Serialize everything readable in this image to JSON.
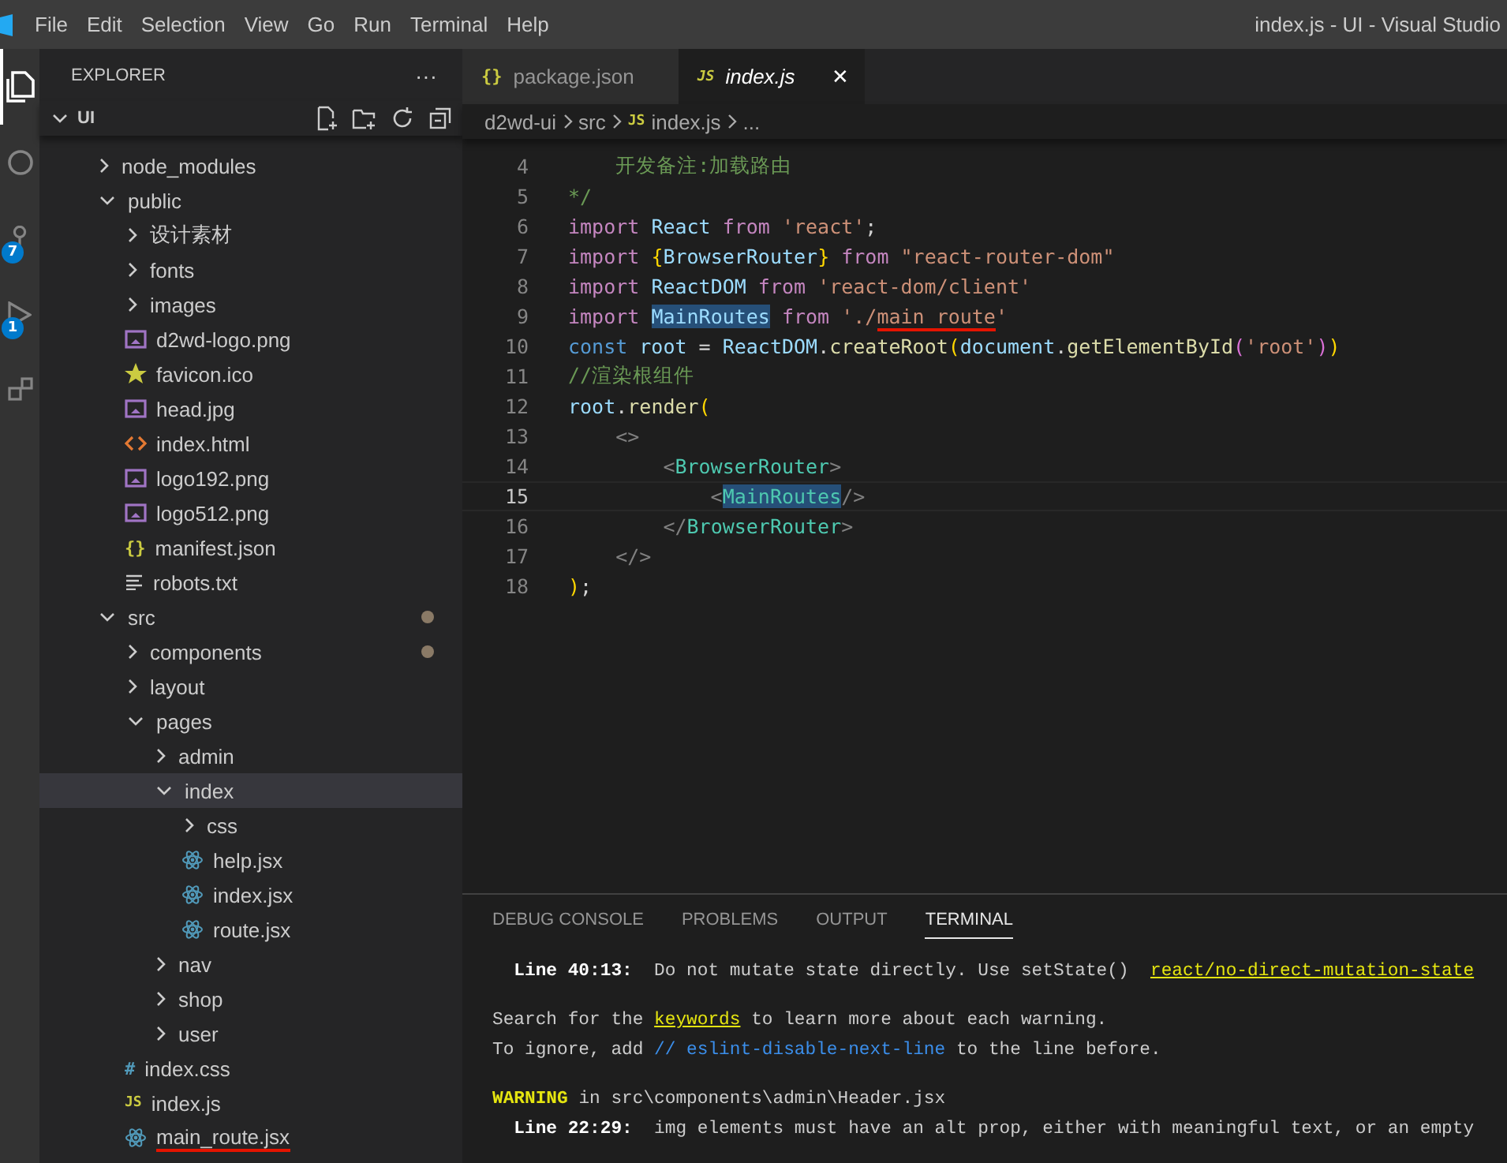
{
  "menu": [
    "File",
    "Edit",
    "Selection",
    "View",
    "Go",
    "Run",
    "Terminal",
    "Help"
  ],
  "window": {
    "title": "index.js - UI - Visual Studio"
  },
  "activity_bar": [
    {
      "kind": "files",
      "selected": true
    },
    {
      "kind": "search",
      "selected": false
    },
    {
      "kind": "source-control",
      "selected": false,
      "badge": "7"
    },
    {
      "kind": "run",
      "selected": false,
      "badge": "1"
    },
    {
      "kind": "extensions",
      "selected": false
    }
  ],
  "sidebar": {
    "title": "EXPLORER",
    "more": "···",
    "root": "UI",
    "tree": [
      {
        "name": "node_modules",
        "kind": "folder",
        "expanded": false,
        "selected": false
      },
      {
        "name": "public",
        "kind": "folder",
        "expanded": true,
        "selected": false,
        "children": [
          {
            "name": "设计素材",
            "kind": "folder",
            "expanded": false,
            "selected": false
          },
          {
            "name": "fonts",
            "kind": "folder",
            "expanded": false,
            "selected": false
          },
          {
            "name": "images",
            "kind": "folder",
            "expanded": false,
            "selected": false
          },
          {
            "name": "d2wd-logo.png",
            "kind": "image",
            "selected": false
          },
          {
            "name": "favicon.ico",
            "kind": "star",
            "selected": false
          },
          {
            "name": "head.jpg",
            "kind": "image",
            "selected": false
          },
          {
            "name": "index.html",
            "kind": "html",
            "selected": false
          },
          {
            "name": "logo192.png",
            "kind": "image",
            "selected": false
          },
          {
            "name": "logo512.png",
            "kind": "image",
            "selected": false
          },
          {
            "name": "manifest.json",
            "kind": "json",
            "icon": "{}",
            "selected": false
          },
          {
            "name": "robots.txt",
            "kind": "text",
            "selected": false
          }
        ]
      },
      {
        "name": "src",
        "kind": "folder",
        "expanded": true,
        "selected": false,
        "modified": true,
        "children": [
          {
            "name": "components",
            "kind": "folder",
            "expanded": false,
            "selected": false,
            "modified": true
          },
          {
            "name": "layout",
            "kind": "folder",
            "expanded": false,
            "selected": false
          },
          {
            "name": "pages",
            "kind": "folder",
            "expanded": true,
            "selected": false,
            "children": [
              {
                "name": "admin",
                "kind": "folder",
                "expanded": false,
                "selected": false
              },
              {
                "name": "index",
                "kind": "folder",
                "expanded": true,
                "selected": true,
                "children": [
                  {
                    "name": "css",
                    "kind": "folder",
                    "expanded": false,
                    "selected": false
                  },
                  {
                    "name": "help.jsx",
                    "kind": "react",
                    "selected": false
                  },
                  {
                    "name": "index.jsx",
                    "kind": "react",
                    "selected": false
                  },
                  {
                    "name": "route.jsx",
                    "kind": "react",
                    "selected": false
                  }
                ]
              },
              {
                "name": "nav",
                "kind": "folder",
                "expanded": false,
                "selected": false
              },
              {
                "name": "shop",
                "kind": "folder",
                "expanded": false,
                "selected": false
              },
              {
                "name": "user",
                "kind": "folder",
                "expanded": false,
                "selected": false
              }
            ]
          },
          {
            "name": "index.css",
            "kind": "css",
            "icon": "#",
            "selected": false
          },
          {
            "name": "index.js",
            "kind": "js",
            "icon": "JS",
            "selected": false
          },
          {
            "name": "main_route.jsx",
            "kind": "react",
            "selected": false,
            "underlined": true
          }
        ]
      }
    ]
  },
  "tabs": [
    {
      "label": "package.json",
      "kind": "json",
      "icon": "{}",
      "selected": false
    },
    {
      "label": "index.js",
      "kind": "js",
      "icon": "JS",
      "selected": true,
      "close": "✕"
    }
  ],
  "breadcrumb": [
    {
      "label": "d2wd-ui"
    },
    {
      "label": "src"
    },
    {
      "label": "index.js",
      "icon": "JS"
    },
    {
      "label": "..."
    }
  ],
  "code": [
    {
      "number": "4",
      "current": false,
      "tokens": [
        {
          "t": "    开发备注:加载路由",
          "kind": "cmt"
        }
      ]
    },
    {
      "number": "5",
      "current": false,
      "tokens": [
        {
          "t": "*/",
          "kind": "cmt"
        }
      ]
    },
    {
      "number": "6",
      "current": false,
      "tokens": [
        {
          "t": "import ",
          "kind": "kw"
        },
        {
          "t": "React ",
          "kind": "var"
        },
        {
          "t": "from ",
          "kind": "kw"
        },
        {
          "t": "'react'",
          "kind": "str"
        },
        {
          "t": ";",
          "kind": "plain"
        }
      ]
    },
    {
      "number": "7",
      "current": false,
      "tokens": [
        {
          "t": "import ",
          "kind": "kw"
        },
        {
          "t": "{",
          "kind": "brace"
        },
        {
          "t": "BrowserRouter",
          "kind": "var"
        },
        {
          "t": "} ",
          "kind": "brace"
        },
        {
          "t": "from ",
          "kind": "kw"
        },
        {
          "t": "\"react-router-dom\"",
          "kind": "str"
        }
      ]
    },
    {
      "number": "8",
      "current": false,
      "tokens": [
        {
          "t": "import ",
          "kind": "kw"
        },
        {
          "t": "ReactDOM ",
          "kind": "var"
        },
        {
          "t": "from ",
          "kind": "kw"
        },
        {
          "t": "'react-dom/client'",
          "kind": "str"
        }
      ]
    },
    {
      "number": "9",
      "current": false,
      "tokens": [
        {
          "t": "import ",
          "kind": "kw"
        },
        {
          "t": "MainRoutes",
          "kind": "var",
          "highlight": true
        },
        {
          "t": " from ",
          "kind": "kw"
        },
        {
          "t": "'./",
          "kind": "str"
        },
        {
          "t": "main route",
          "kind": "str",
          "underlined": true
        },
        {
          "t": "'",
          "kind": "str"
        }
      ]
    },
    {
      "number": "10",
      "current": false,
      "tokens": [
        {
          "t": "const ",
          "kind": "decl"
        },
        {
          "t": "root ",
          "kind": "var"
        },
        {
          "t": "= ",
          "kind": "plain"
        },
        {
          "t": "ReactDOM",
          "kind": "var"
        },
        {
          "t": ".",
          "kind": "plain"
        },
        {
          "t": "createRoot",
          "kind": "fn"
        },
        {
          "t": "(",
          "kind": "brace"
        },
        {
          "t": "document",
          "kind": "var"
        },
        {
          "t": ".",
          "kind": "plain"
        },
        {
          "t": "getElementById",
          "kind": "fn"
        },
        {
          "t": "(",
          "kind": "paren"
        },
        {
          "t": "'root'",
          "kind": "str"
        },
        {
          "t": ")",
          "kind": "paren"
        },
        {
          "t": ")",
          "kind": "brace"
        }
      ]
    },
    {
      "number": "11",
      "current": false,
      "tokens": [
        {
          "t": "//渲染根组件",
          "kind": "cmt"
        }
      ]
    },
    {
      "number": "12",
      "current": false,
      "tokens": [
        {
          "t": "root",
          "kind": "var"
        },
        {
          "t": ".",
          "kind": "plain"
        },
        {
          "t": "render",
          "kind": "fn"
        },
        {
          "t": "(",
          "kind": "brace"
        }
      ]
    },
    {
      "number": "13",
      "current": false,
      "tokens": [
        {
          "t": "    <>",
          "kind": "punct"
        }
      ]
    },
    {
      "number": "14",
      "current": false,
      "tokens": [
        {
          "t": "        <",
          "kind": "punct"
        },
        {
          "t": "BrowserRouter",
          "kind": "tag"
        },
        {
          "t": ">",
          "kind": "punct"
        }
      ]
    },
    {
      "number": "15",
      "current": true,
      "tokens": [
        {
          "t": "            <",
          "kind": "punct"
        },
        {
          "t": "MainRoutes",
          "kind": "tag",
          "highlight": true
        },
        {
          "t": "/>",
          "kind": "punct"
        }
      ]
    },
    {
      "number": "16",
      "current": false,
      "tokens": [
        {
          "t": "        </",
          "kind": "punct"
        },
        {
          "t": "BrowserRouter",
          "kind": "tag"
        },
        {
          "t": ">",
          "kind": "punct"
        }
      ]
    },
    {
      "number": "17",
      "current": false,
      "tokens": [
        {
          "t": "    </>",
          "kind": "punct"
        }
      ]
    },
    {
      "number": "18",
      "current": false,
      "tokens": [
        {
          "t": ")",
          "kind": "brace"
        },
        {
          "t": ";",
          "kind": "plain"
        }
      ]
    }
  ],
  "panel": {
    "tabs": [
      {
        "label": "DEBUG CONSOLE",
        "selected": false
      },
      {
        "label": "PROBLEMS",
        "selected": false
      },
      {
        "label": "OUTPUT",
        "selected": false
      },
      {
        "label": "TERMINAL",
        "selected": true
      }
    ],
    "terminal": [
      [
        [
          {
            "t": "  Line 40:13:",
            "kind": "bold"
          },
          {
            "t": "  Do not mutate state directly. Use setState()  ",
            "kind": "plain"
          },
          {
            "t": "react/no-direct-mutation-state",
            "kind": "link"
          }
        ]
      ],
      [
        [
          {
            "t": "Search for the ",
            "kind": "plain"
          },
          {
            "t": "keywords",
            "kind": "link"
          },
          {
            "t": " to learn more about each warning.",
            "kind": "plain"
          }
        ],
        [
          {
            "t": "To ignore, add ",
            "kind": "plain"
          },
          {
            "t": "// eslint-disable-next-line",
            "kind": "blue"
          },
          {
            "t": " to the line before.",
            "kind": "plain"
          }
        ]
      ],
      [
        [
          {
            "t": "WARNING",
            "kind": "warn"
          },
          {
            "t": " in src\\components\\admin\\Header.jsx",
            "kind": "plain"
          }
        ],
        [
          {
            "t": "  Line 22:29:",
            "kind": "bold"
          },
          {
            "t": "  img elements must have an alt prop, either with meaningful text, or an empty",
            "kind": "plain"
          }
        ]
      ]
    ]
  }
}
